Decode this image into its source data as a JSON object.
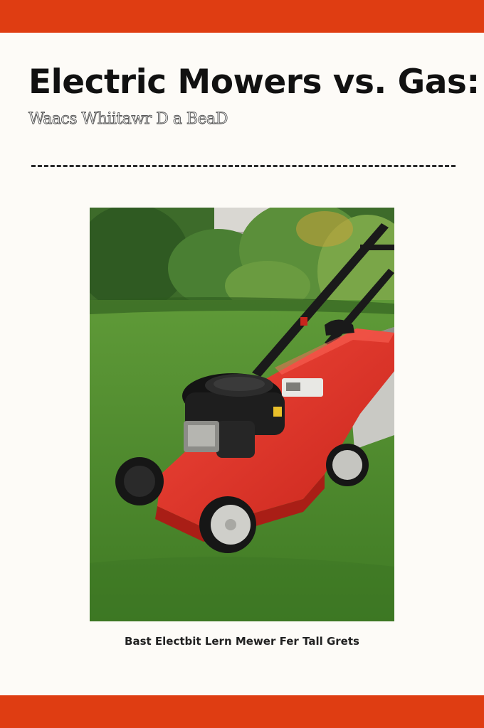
{
  "header": {
    "title": "Electric Mowers vs. Gas:",
    "subtitle": "Waacs Whiitawr D a BeaD"
  },
  "image": {
    "subject": "red-lawn-mower-on-grass"
  },
  "caption": "Bast Electbit Lern Mewer Fer Tall Grets",
  "colors": {
    "accent_bar": "#df3d12",
    "background": "#fdfbf7",
    "mower_red": "#e8392f",
    "engine_black": "#1e1e1e",
    "grass": "#4e8b2e"
  }
}
